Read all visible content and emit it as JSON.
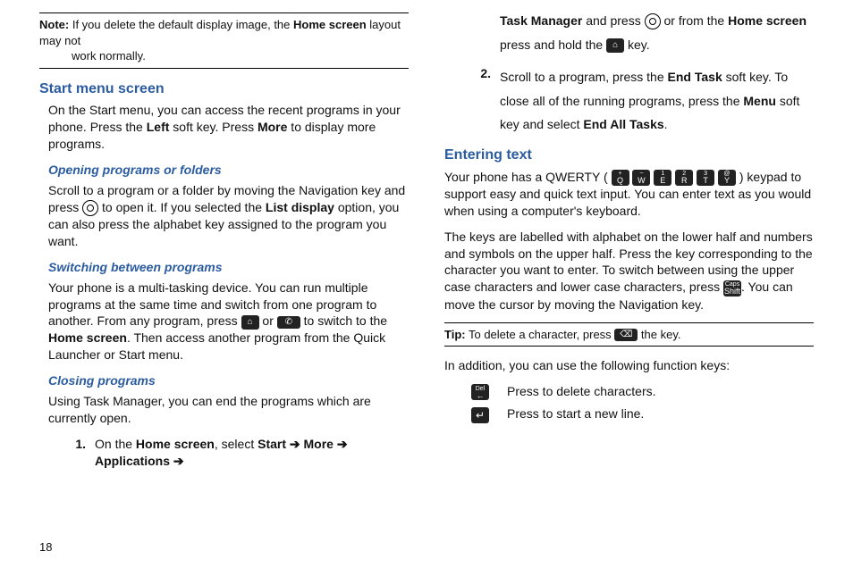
{
  "page_number": "18",
  "note": {
    "label": "Note:",
    "line1": "If you delete the default display image, the ",
    "bold1": "Home screen",
    "line2": " layout may not",
    "line3": "work normally."
  },
  "col1": {
    "h_start": "Start menu screen",
    "p_start_a": "On the Start menu, you can access the recent programs in your phone. Press the ",
    "p_start_b": "Left",
    "p_start_c": " soft key. Press ",
    "p_start_d": "More",
    "p_start_e": " to display more programs.",
    "h_open": "Opening programs or folders",
    "p_open_a": "Scroll to a program or a folder by moving the Navigation key and press ",
    "p_open_b": " to open it. If you selected the ",
    "p_open_c": "List display",
    "p_open_d": " option, you can also press the alphabet key assigned to the program you want.",
    "h_switch": "Switching between programs",
    "p_switch_a": "Your phone is a multi-tasking device. You can run multiple programs at the same time and switch from one program to another. From any program, press ",
    "p_switch_b": " or ",
    "p_switch_c": " to switch to the ",
    "p_switch_d": "Home screen",
    "p_switch_e": ". Then access another program from the Quick Launcher or Start menu.",
    "h_close": "Closing programs",
    "p_close": "Using Task Manager, you can end the programs which are currently open.",
    "step1_num": "1.",
    "step1_a": "On the ",
    "step1_b": "Home screen",
    "step1_c": ", select ",
    "step1_d": "Start ➔ More ➔ Applications ➔"
  },
  "col2": {
    "cont_a": "Task Manager",
    "cont_b": " and press ",
    "cont_c": " or from the ",
    "cont_d": "Home screen",
    "cont_e": " press and hold the ",
    "cont_f": " key.",
    "step2_num": "2.",
    "step2_a": "Scroll to a program, press the ",
    "step2_b": "End Task",
    "step2_c": " soft key. To close all of the running programs, press the ",
    "step2_d": "Menu",
    "step2_e": " soft key and select ",
    "step2_f": "End All Tasks",
    "step2_g": ".",
    "h_enter": "Entering text",
    "p_enter1_a": "Your phone has a QWERTY ( ",
    "p_enter1_b": " ) keypad to support easy and quick text input. You can enter text as you would when using a computer's keyboard.",
    "p_enter2_a": "The keys are labelled with alphabet on the lower half and numbers and symbols on the upper half. Press the key corresponding to the character you want to enter. To switch between using the upper case characters and lower case characters, press ",
    "p_enter2_b": ". You can move the cursor by moving the Navigation key.",
    "tip_label": "Tip:",
    "tip_a": " To delete a character, press ",
    "tip_b": " the key.",
    "p_addition": "In addition, you can use the following function keys:",
    "fn1": "Press to delete characters.",
    "fn2": "Press to start a new line."
  },
  "icons": {
    "home": "⌂",
    "phone": "✆",
    "del_small": "⌫",
    "q": {
      "sup": "+",
      "main": "Q"
    },
    "w": {
      "sup": "−",
      "main": "W"
    },
    "e": {
      "sup": "1",
      "main": "E"
    },
    "r": {
      "sup": "2",
      "main": "R"
    },
    "t": {
      "sup": "3",
      "main": "T"
    },
    "y": {
      "sup": "@",
      "main": "Y"
    },
    "caps": {
      "sup": "Caps",
      "main": "Shift"
    },
    "del": {
      "sup": "Del",
      "main": "←"
    },
    "enter": "↵"
  }
}
